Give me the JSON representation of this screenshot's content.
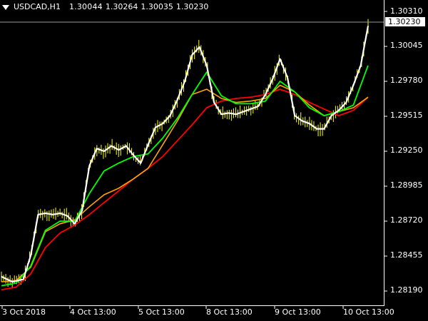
{
  "header": {
    "symbol": "USDCAD,H1",
    "open": "1.30044",
    "high": "1.30264",
    "low": "1.30035",
    "close": "1.30230"
  },
  "current_price": "1.30230",
  "y_axis": {
    "ticks": [
      "1.30310",
      "1.30045",
      "1.29780",
      "1.29515",
      "1.29250",
      "1.28985",
      "1.28720",
      "1.28455",
      "1.28190"
    ]
  },
  "x_axis": {
    "ticks": [
      "3 Oct 2018",
      "4 Oct 13:00",
      "5 Oct 13:00",
      "8 Oct 13:00",
      "9 Oct 13:00",
      "10 Oct 13:00"
    ]
  },
  "colors": {
    "background": "#000000",
    "bars": "#ffff00",
    "price_line": "#ffffff",
    "ma_fast": "#00ff00",
    "ma_mid": "#ffa500",
    "ma_slow": "#ff0000",
    "grid_price_line": "#9a9a9a"
  },
  "chart_data": {
    "type": "line",
    "x_index_max": 100,
    "ylim": [
      1.2813,
      1.3032
    ],
    "bars_color": "yellow",
    "series": [
      {
        "key": "price",
        "x": [
          0,
          3,
          6,
          8,
          10,
          12,
          14,
          16,
          18,
          20,
          22,
          24,
          26,
          28,
          30,
          32,
          34,
          36,
          38,
          40,
          42,
          44,
          46,
          48,
          50,
          52,
          54,
          56,
          58,
          60,
          62,
          64,
          66,
          68,
          70,
          72,
          74,
          76,
          78,
          80,
          82,
          84,
          86,
          88,
          90,
          92,
          94,
          96,
          98,
          100
        ],
        "y": [
          1.283,
          1.2826,
          1.2828,
          1.2846,
          1.2877,
          1.2878,
          1.2877,
          1.2878,
          1.2876,
          1.287,
          1.288,
          1.2914,
          1.2927,
          1.2925,
          1.2929,
          1.2926,
          1.2929,
          1.2922,
          1.2916,
          1.293,
          1.2943,
          1.2946,
          1.2952,
          1.2964,
          1.2978,
          1.2998,
          1.3004,
          1.299,
          1.2962,
          1.2953,
          1.2954,
          1.2953,
          1.2955,
          1.2957,
          1.2959,
          1.2968,
          1.298,
          1.2995,
          1.2981,
          1.2952,
          1.2948,
          1.2946,
          1.2942,
          1.2942,
          1.2952,
          1.2956,
          1.2962,
          1.2975,
          1.299,
          1.302
        ]
      },
      {
        "key": "ma_fast",
        "x": [
          0,
          4,
          8,
          12,
          16,
          20,
          24,
          28,
          32,
          36,
          40,
          44,
          48,
          52,
          56,
          60,
          64,
          68,
          72,
          76,
          80,
          84,
          88,
          92,
          96,
          100
        ],
        "y": [
          1.2823,
          1.2825,
          1.2838,
          1.2865,
          1.2872,
          1.2872,
          1.2893,
          1.291,
          1.2916,
          1.2921,
          1.2923,
          1.2935,
          1.295,
          1.2968,
          1.2985,
          1.2967,
          1.2961,
          1.2961,
          1.2963,
          1.2978,
          1.297,
          1.2958,
          1.2952,
          1.2955,
          1.296,
          1.299
        ]
      },
      {
        "key": "ma_mid",
        "x": [
          0,
          4,
          8,
          12,
          16,
          20,
          24,
          28,
          32,
          36,
          40,
          44,
          48,
          52,
          56,
          60,
          64,
          68,
          72,
          76,
          80,
          84,
          88,
          92,
          96,
          100
        ],
        "y": [
          1.2826,
          1.2827,
          1.2837,
          1.2864,
          1.287,
          1.2873,
          1.2883,
          1.2892,
          1.2897,
          1.2904,
          1.2912,
          1.293,
          1.2948,
          1.2968,
          1.2972,
          1.2965,
          1.2962,
          1.2963,
          1.2965,
          1.2975,
          1.297,
          1.296,
          1.2952,
          1.2955,
          1.2958,
          1.2966
        ]
      },
      {
        "key": "ma_slow",
        "x": [
          0,
          4,
          8,
          12,
          16,
          20,
          24,
          28,
          32,
          36,
          40,
          44,
          48,
          52,
          56,
          60,
          64,
          68,
          72,
          76,
          80,
          84,
          88,
          92,
          96,
          100
        ],
        "y": [
          1.282,
          1.2822,
          1.2832,
          1.2852,
          1.2863,
          1.2869,
          1.2877,
          1.2886,
          1.2895,
          1.2904,
          1.2912,
          1.2921,
          1.2933,
          1.2945,
          1.2958,
          1.2963,
          1.2965,
          1.2966,
          1.2968,
          1.2972,
          1.2968,
          1.2962,
          1.2957,
          1.2952,
          1.2956,
          1.2966
        ]
      }
    ]
  }
}
